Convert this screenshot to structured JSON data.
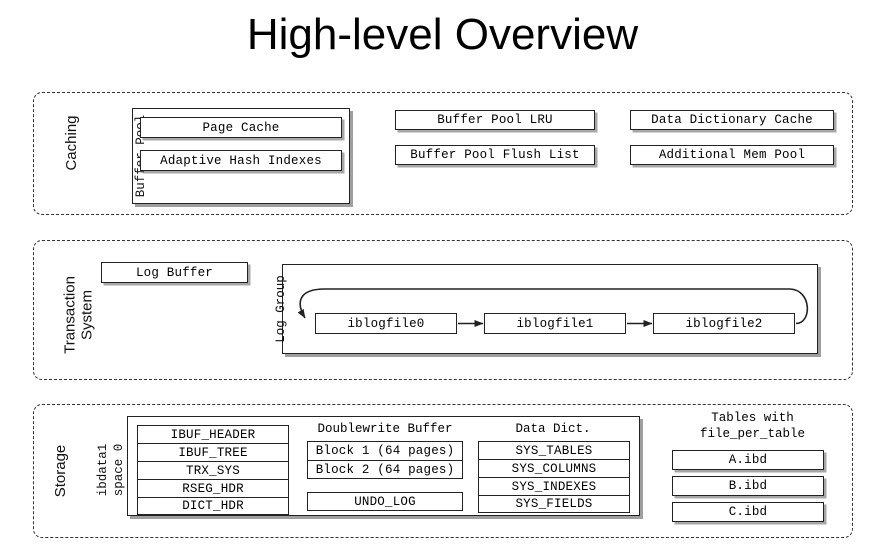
{
  "title": "High-level Overview",
  "sections": [
    {
      "id": "caching",
      "label": "Caching"
    },
    {
      "id": "transaction",
      "label": "Transaction\nSystem",
      "line1": "Transaction",
      "line2": "System"
    },
    {
      "id": "storage",
      "label": "Storage"
    }
  ],
  "caching": {
    "buffer_pool": {
      "vlabel": "Buffer Pool",
      "items": [
        {
          "label": "Page Cache"
        },
        {
          "label": "Adaptive Hash Indexes"
        }
      ]
    },
    "structures": [
      {
        "label": "Buffer Pool LRU"
      },
      {
        "label": "Data Dictionary Cache"
      },
      {
        "label": "Buffer Pool Flush List"
      },
      {
        "label": "Additional Mem Pool"
      }
    ]
  },
  "transaction": {
    "log_buffer": {
      "label": "Log Buffer"
    },
    "log_group": {
      "vlabel": "Log Group",
      "files": [
        {
          "label": "iblogfile0"
        },
        {
          "label": "iblogfile1"
        },
        {
          "label": "iblogfile2"
        }
      ]
    }
  },
  "storage": {
    "ibdata1": {
      "vlabel_line1": "ibdata1",
      "vlabel_line2": "space 0",
      "rows": [
        {
          "label": "IBUF_HEADER"
        },
        {
          "label": "IBUF_TREE"
        },
        {
          "label": "TRX_SYS"
        },
        {
          "label": "RSEG_HDR"
        },
        {
          "label": "DICT_HDR"
        }
      ]
    },
    "doublewrite": {
      "title": "Doublewrite Buffer",
      "blocks": [
        {
          "label": "Block 1 (64 pages)"
        },
        {
          "label": "Block 2 (64 pages)"
        }
      ],
      "undo": {
        "label": "UNDO_LOG"
      }
    },
    "data_dict": {
      "title": "Data Dict.",
      "rows": [
        {
          "label": "SYS_TABLES"
        },
        {
          "label": "SYS_COLUMNS"
        },
        {
          "label": "SYS_INDEXES"
        },
        {
          "label": "SYS_FIELDS"
        }
      ]
    },
    "file_per_table": {
      "title_line1": "Tables with",
      "title_line2": "file_per_table",
      "files": [
        {
          "label": "A.ibd"
        },
        {
          "label": "B.ibd"
        },
        {
          "label": "C.ibd"
        }
      ]
    }
  },
  "colors": {
    "stroke": "#222222",
    "dashed": "#333333",
    "background": "#ffffff",
    "shadow": "rgba(80,80,80,0.55)"
  }
}
